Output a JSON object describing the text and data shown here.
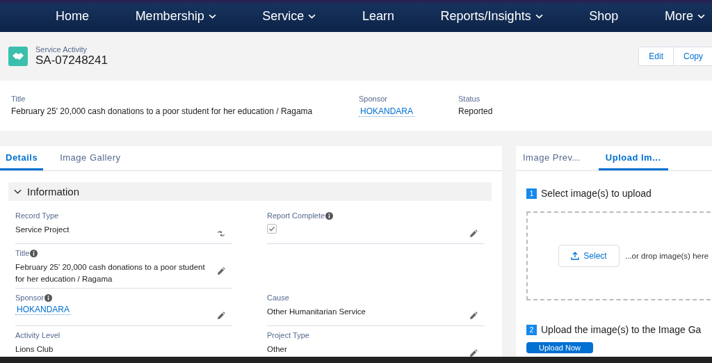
{
  "nav": [
    {
      "label": "Home",
      "has_menu": false
    },
    {
      "label": "Membership",
      "has_menu": true
    },
    {
      "label": "Service",
      "has_menu": true
    },
    {
      "label": "Learn",
      "has_menu": false
    },
    {
      "label": "Reports/Insights",
      "has_menu": true
    },
    {
      "label": "Shop",
      "has_menu": false
    },
    {
      "label": "More",
      "has_menu": true
    }
  ],
  "record": {
    "object": "Service Activity",
    "name": "SA-07248241",
    "actions": [
      "Edit",
      "Copy"
    ]
  },
  "highlights": [
    {
      "label": "Title",
      "value": "February 25' 20,000 cash donations to a poor student for her education / Ragama",
      "kind": "text"
    },
    {
      "label": "Sponsor",
      "value": "HOKANDARA",
      "kind": "link"
    },
    {
      "label": "Status",
      "value": "Reported",
      "kind": "text"
    }
  ],
  "detail_tabs": [
    {
      "label": "Details",
      "selected": true
    },
    {
      "label": "Image Gallery",
      "selected": false
    }
  ],
  "section": {
    "title": "Information",
    "expanded": true
  },
  "rows": [
    {
      "left": {
        "label": "Record Type",
        "info": false,
        "kind": "text",
        "value": "Service Project",
        "action": {
          "kind": "change-type"
        }
      },
      "right": {
        "label": "Report Complete",
        "info": true,
        "kind": "checkbox",
        "checked": true,
        "action": {
          "kind": "edit"
        }
      }
    },
    {
      "left": {
        "label": "Title",
        "info": true,
        "kind": "text",
        "value": "February 25' 20,000 cash donations to a poor student for her education / Ragama",
        "action": {
          "kind": "edit"
        }
      }
    },
    {
      "left": {
        "label": "Sponsor",
        "info": true,
        "kind": "link",
        "value": "HOKANDARA",
        "action": {
          "kind": "edit"
        }
      },
      "right": {
        "label": "Cause",
        "info": false,
        "kind": "text",
        "value": "Other Humanitarian Service",
        "action": {
          "kind": "edit"
        }
      }
    },
    {
      "left": {
        "label": "Activity Level",
        "info": false,
        "kind": "text",
        "value": "Lions Club"
      },
      "right": {
        "label": "Project Type",
        "info": false,
        "kind": "text",
        "value": "Other",
        "action": {
          "kind": "edit"
        }
      }
    }
  ],
  "side_tabs": [
    {
      "label": "Image Prev...",
      "selected": false
    },
    {
      "label": "Upload Im...",
      "selected": true
    }
  ],
  "upload": {
    "step1": {
      "number": "1",
      "text": "Select image(s) to upload"
    },
    "select_button": "Select",
    "drop_hint": "...or drop image(s) here",
    "step2": {
      "number": "2",
      "text": "Upload the image(s) to the Image Ga"
    },
    "upload_button": "Upload Now"
  }
}
